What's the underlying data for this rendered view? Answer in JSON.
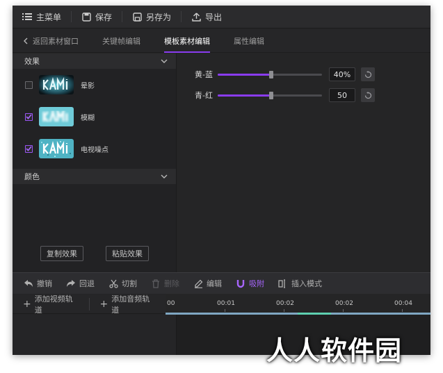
{
  "menubar": {
    "main_menu": "主菜单",
    "save": "保存",
    "save_as": "另存为",
    "export": "导出"
  },
  "tabs": {
    "back": "返回素材窗口",
    "keyframe": "关键帧编辑",
    "template": "模板素材编辑",
    "property": "属性编辑",
    "active": "模板素材编辑"
  },
  "effects": {
    "section_title": "效果",
    "items": [
      {
        "label": "晕影",
        "checked": false
      },
      {
        "label": "模糊",
        "checked": true
      },
      {
        "label": "电视噪点",
        "checked": true
      }
    ],
    "color_section_title": "颜色",
    "copy_button": "复制效果",
    "paste_button": "粘贴效果"
  },
  "properties": {
    "items": [
      {
        "label": "黄-蓝",
        "value": "40%",
        "fraction": 0.51
      },
      {
        "label": "青-红",
        "value": "50",
        "fraction": 0.51
      }
    ]
  },
  "toolbar": {
    "undo": "撤销",
    "redo": "回退",
    "cut": "切割",
    "delete": "删除",
    "edit": "编辑",
    "snap": "吸附",
    "insert_mode": "插入模式"
  },
  "timeline": {
    "add_video_track": "添加视频轨道",
    "add_audio_track": "添加音频轨道",
    "ticks": [
      "00",
      "00:01",
      "00:02",
      "00:02",
      "00:04"
    ]
  },
  "watermark": "人人软件园",
  "colors": {
    "accent": "#8a3cf0",
    "panel": "#252526",
    "track_line": "#7fa7c2",
    "track_segment": "#5ed0b0"
  }
}
